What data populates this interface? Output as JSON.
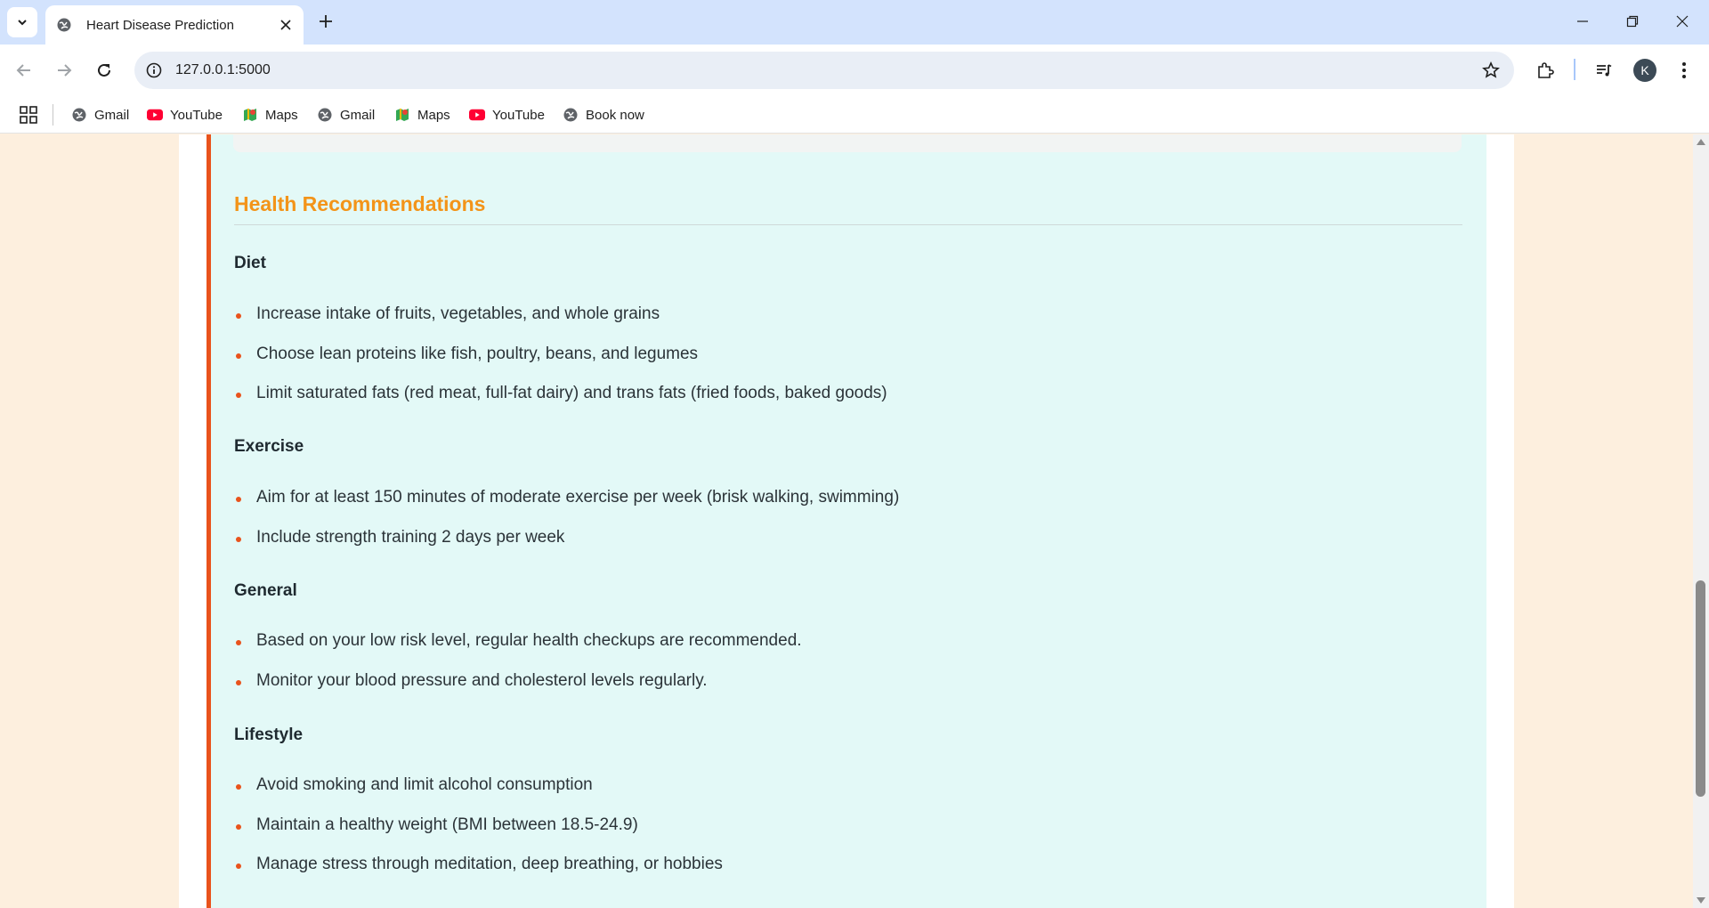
{
  "browser": {
    "tab_title": "Heart Disease Prediction",
    "url": "127.0.0.1:5000",
    "profile_initial": "K",
    "bookmarks": [
      {
        "label": "Gmail",
        "icon": "globe-icon"
      },
      {
        "label": "YouTube",
        "icon": "youtube-icon"
      },
      {
        "label": "Maps",
        "icon": "maps-icon"
      },
      {
        "label": "Gmail",
        "icon": "globe-icon"
      },
      {
        "label": "Maps",
        "icon": "maps-icon"
      },
      {
        "label": "YouTube",
        "icon": "youtube-icon"
      },
      {
        "label": "Book now",
        "icon": "globe-icon"
      }
    ]
  },
  "recommendations": {
    "title": "Health Recommendations",
    "sections": [
      {
        "heading": "Diet",
        "items": [
          "Increase intake of fruits, vegetables, and whole grains",
          "Choose lean proteins like fish, poultry, beans, and legumes",
          "Limit saturated fats (red meat, full-fat dairy) and trans fats (fried foods, baked goods)"
        ]
      },
      {
        "heading": "Exercise",
        "items": [
          "Aim for at least 150 minutes of moderate exercise per week (brisk walking, swimming)",
          "Include strength training 2 days per week"
        ]
      },
      {
        "heading": "General",
        "items": [
          "Based on your low risk level, regular health checkups are recommended.",
          "Monitor your blood pressure and cholesterol levels regularly."
        ]
      },
      {
        "heading": "Lifestyle",
        "items": [
          "Avoid smoking and limit alcohol consumption",
          "Maintain a healthy weight (BMI between 18.5-24.9)",
          "Manage stress through meditation, deep breathing, or hobbies"
        ]
      }
    ]
  },
  "colors": {
    "accent_orange": "#f39419",
    "border_red": "#e9531c",
    "card_bg": "#e3f9f7",
    "page_bg": "#fdefde"
  }
}
